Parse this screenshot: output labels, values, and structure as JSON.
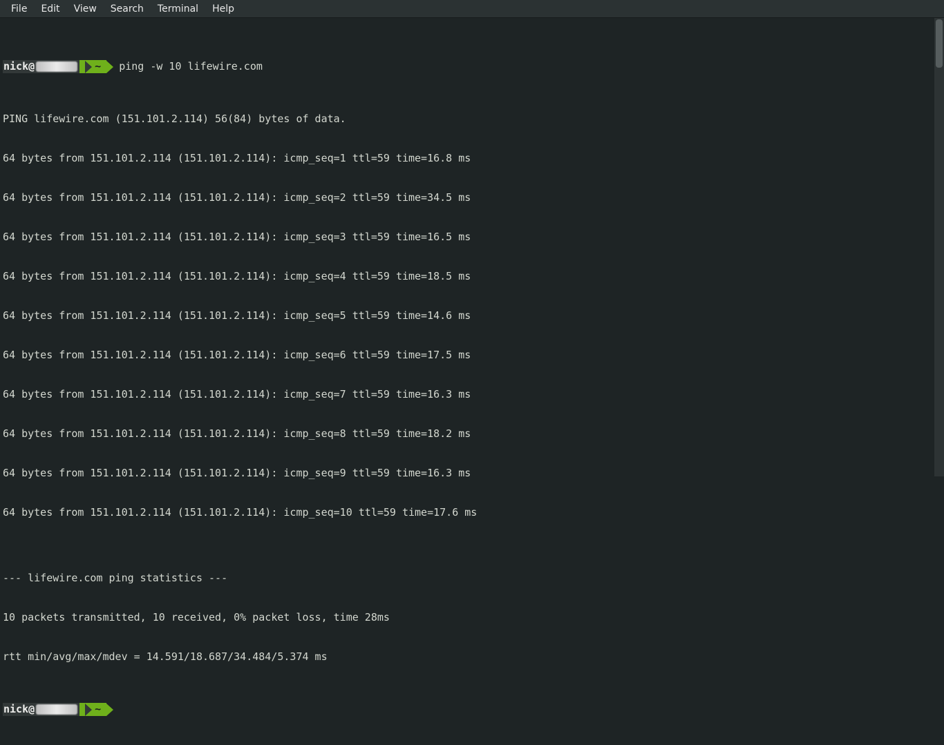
{
  "menubar": {
    "items": [
      "File",
      "Edit",
      "View",
      "Search",
      "Terminal",
      "Help"
    ]
  },
  "terminal": {
    "prompt1": {
      "user": "nick@",
      "path": "~",
      "command": "ping -w 10 lifewire.com"
    },
    "output": {
      "header": "PING lifewire.com (151.101.2.114) 56(84) bytes of data.",
      "replies": [
        "64 bytes from 151.101.2.114 (151.101.2.114): icmp_seq=1 ttl=59 time=16.8 ms",
        "64 bytes from 151.101.2.114 (151.101.2.114): icmp_seq=2 ttl=59 time=34.5 ms",
        "64 bytes from 151.101.2.114 (151.101.2.114): icmp_seq=3 ttl=59 time=16.5 ms",
        "64 bytes from 151.101.2.114 (151.101.2.114): icmp_seq=4 ttl=59 time=18.5 ms",
        "64 bytes from 151.101.2.114 (151.101.2.114): icmp_seq=5 ttl=59 time=14.6 ms",
        "64 bytes from 151.101.2.114 (151.101.2.114): icmp_seq=6 ttl=59 time=17.5 ms",
        "64 bytes from 151.101.2.114 (151.101.2.114): icmp_seq=7 ttl=59 time=16.3 ms",
        "64 bytes from 151.101.2.114 (151.101.2.114): icmp_seq=8 ttl=59 time=18.2 ms",
        "64 bytes from 151.101.2.114 (151.101.2.114): icmp_seq=9 ttl=59 time=16.3 ms",
        "64 bytes from 151.101.2.114 (151.101.2.114): icmp_seq=10 ttl=59 time=17.6 ms"
      ],
      "blank": "",
      "stats_header": "--- lifewire.com ping statistics ---",
      "stats_line1": "10 packets transmitted, 10 received, 0% packet loss, time 28ms",
      "stats_line2": "rtt min/avg/max/mdev = 14.591/18.687/34.484/5.374 ms"
    },
    "prompt2": {
      "user": "nick@",
      "path": "~",
      "command": ""
    }
  }
}
